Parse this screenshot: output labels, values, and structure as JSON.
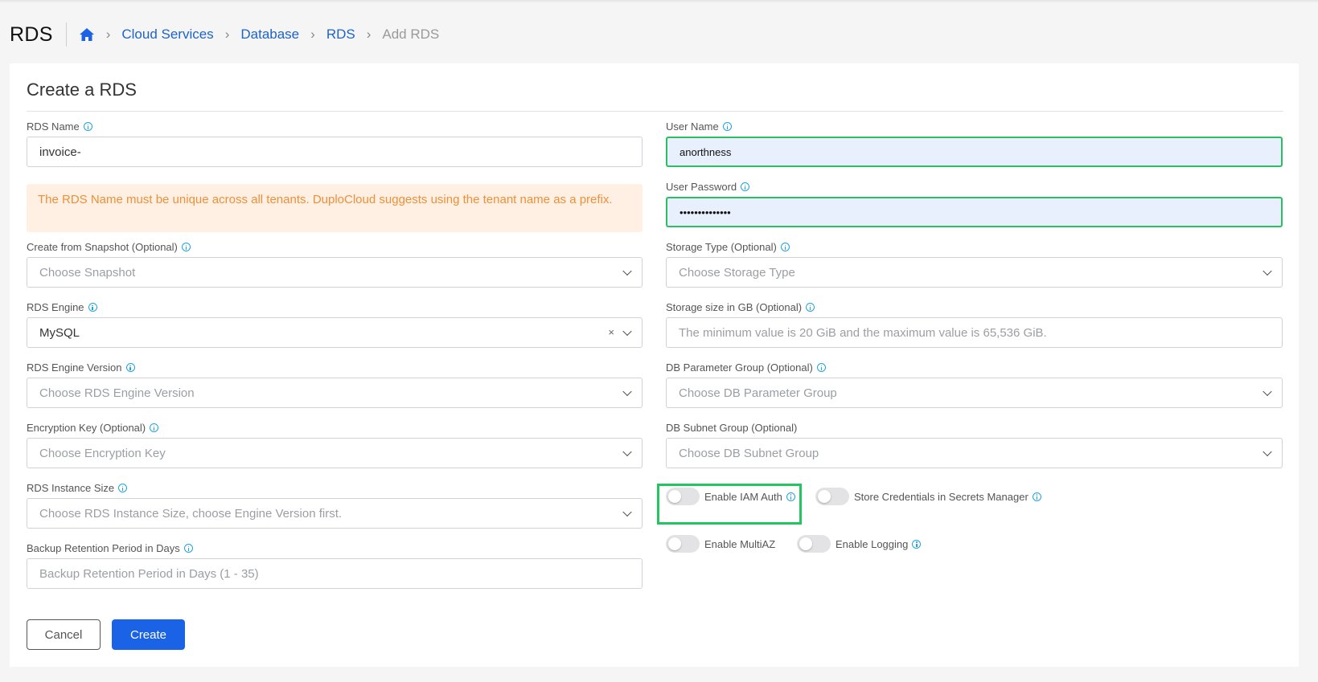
{
  "header": {
    "title": "RDS",
    "breadcrumbs": [
      "Cloud Services",
      "Database",
      "RDS"
    ],
    "current": "Add RDS"
  },
  "form": {
    "title": "Create a RDS",
    "rds_name": {
      "label": "RDS Name",
      "value": "invoice-"
    },
    "warning": "The RDS Name must be unique across all tenants. DuploCloud suggests using the tenant name as a prefix.",
    "snapshot": {
      "label": "Create from Snapshot (Optional)",
      "placeholder": "Choose Snapshot"
    },
    "engine": {
      "label": "RDS Engine",
      "value": "MySQL",
      "clear": "×"
    },
    "engine_version": {
      "label": "RDS Engine Version",
      "placeholder": "Choose RDS Engine Version"
    },
    "encryption_key": {
      "label": "Encryption Key (Optional)",
      "placeholder": "Choose Encryption Key"
    },
    "instance_size": {
      "label": "RDS Instance Size",
      "placeholder": "Choose RDS Instance Size, choose Engine Version first."
    },
    "backup_retention": {
      "label": "Backup Retention Period in Days",
      "placeholder": "Backup Retention Period in Days (1 - 35)"
    },
    "user_name": {
      "label": "User Name",
      "value": "anorthness"
    },
    "user_password": {
      "label": "User Password",
      "value": "••••••••••••••"
    },
    "storage_type": {
      "label": "Storage Type (Optional)",
      "placeholder": "Choose Storage Type"
    },
    "storage_size": {
      "label": "Storage size in GB (Optional)",
      "placeholder": "The minimum value is 20 GiB and the maximum value is 65,536 GiB."
    },
    "db_param_group": {
      "label": "DB Parameter Group (Optional)",
      "placeholder": "Choose DB Parameter Group"
    },
    "db_subnet_group": {
      "label": "DB Subnet Group (Optional)",
      "placeholder": "Choose DB Subnet Group"
    },
    "toggles": {
      "iam_auth": {
        "label": "Enable IAM Auth",
        "on": false
      },
      "store_credentials": {
        "label": "Store Credentials in Secrets Manager",
        "on": false
      },
      "multi_az": {
        "label": "Enable MultiAZ",
        "on": false
      },
      "logging": {
        "label": "Enable Logging",
        "on": false
      }
    },
    "buttons": {
      "cancel": "Cancel",
      "create": "Create"
    }
  },
  "colors": {
    "primary": "#1a63e6",
    "link": "#1e63c9",
    "warning_text": "#ef8f37",
    "warning_bg": "#fff0e3",
    "success_border": "#2cbf62",
    "highlight": "#22c55e"
  }
}
